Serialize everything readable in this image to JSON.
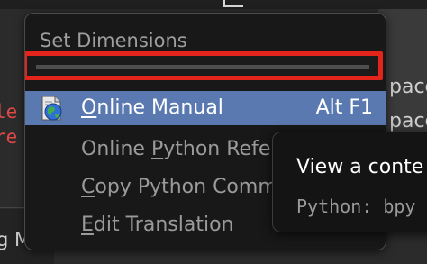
{
  "background": {
    "right_rows": [
      "pace",
      "pace"
    ],
    "left_code": [
      "le",
      "re"
    ],
    "bottom_text": "g M"
  },
  "menu": {
    "title": "Set Dimensions",
    "items": [
      {
        "prefix": "",
        "mnemonic": "O",
        "rest": "nline Manual",
        "shortcut": "Alt F1",
        "active": true,
        "icon": "manual-globe-icon"
      },
      {
        "prefix": "Online ",
        "mnemonic": "P",
        "rest": "ython Reference",
        "shortcut": "",
        "active": false
      },
      {
        "prefix": "",
        "mnemonic": "C",
        "rest": "opy Python Command",
        "shortcut": "",
        "active": false
      },
      {
        "prefix": "",
        "mnemonic": "E",
        "rest": "dit Translation",
        "shortcut": "",
        "active": false
      }
    ]
  },
  "tooltip": {
    "description": "View a conte",
    "python": "Python: bpy"
  },
  "colors": {
    "highlight": "#5a79b0",
    "annotation_box": "#e3241b"
  }
}
